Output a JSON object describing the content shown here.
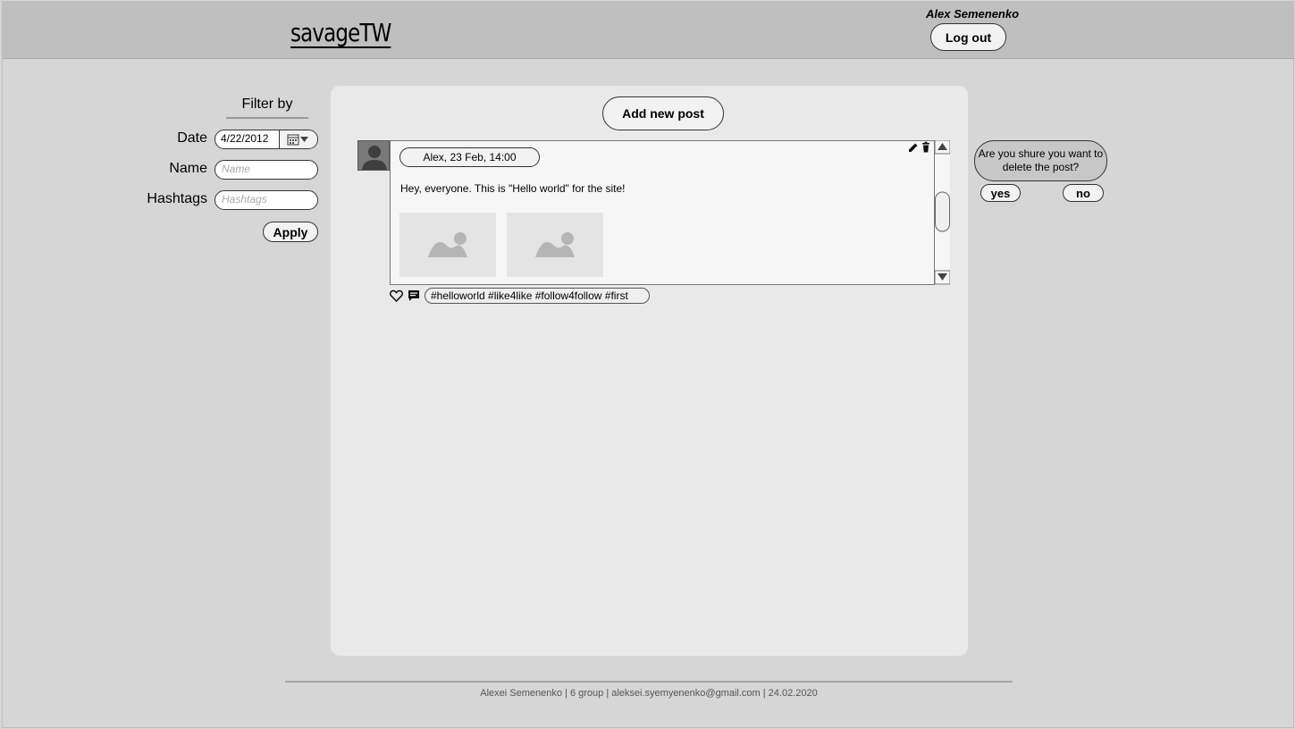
{
  "header": {
    "logo": "savageTW",
    "username": "Alex Semenenko",
    "logout_label": "Log out"
  },
  "filter": {
    "title": "Filter by",
    "date_label": "Date",
    "date_value": "4/22/2012",
    "name_label": "Name",
    "name_placeholder": "Name",
    "hashtags_label": "Hashtags",
    "hashtags_placeholder": "Hashtags",
    "apply_label": "Apply"
  },
  "feed": {
    "add_post_label": "Add new post",
    "posts": [
      {
        "author_date": "Alex, 23 Feb, 14:00",
        "text": "Hey, everyone. This is \"Hello world\" for the site!",
        "hashtags": "#helloworld #like4like #follow4follow #first"
      }
    ]
  },
  "confirm_dialog": {
    "message": "Are you shure you want to delete the post?",
    "yes_label": "yes",
    "no_label": "no"
  },
  "footer": {
    "text": "Alexei Semenenko | 6 group | aleksei.syemyenenko@gmail.com | 24.02.2020"
  }
}
